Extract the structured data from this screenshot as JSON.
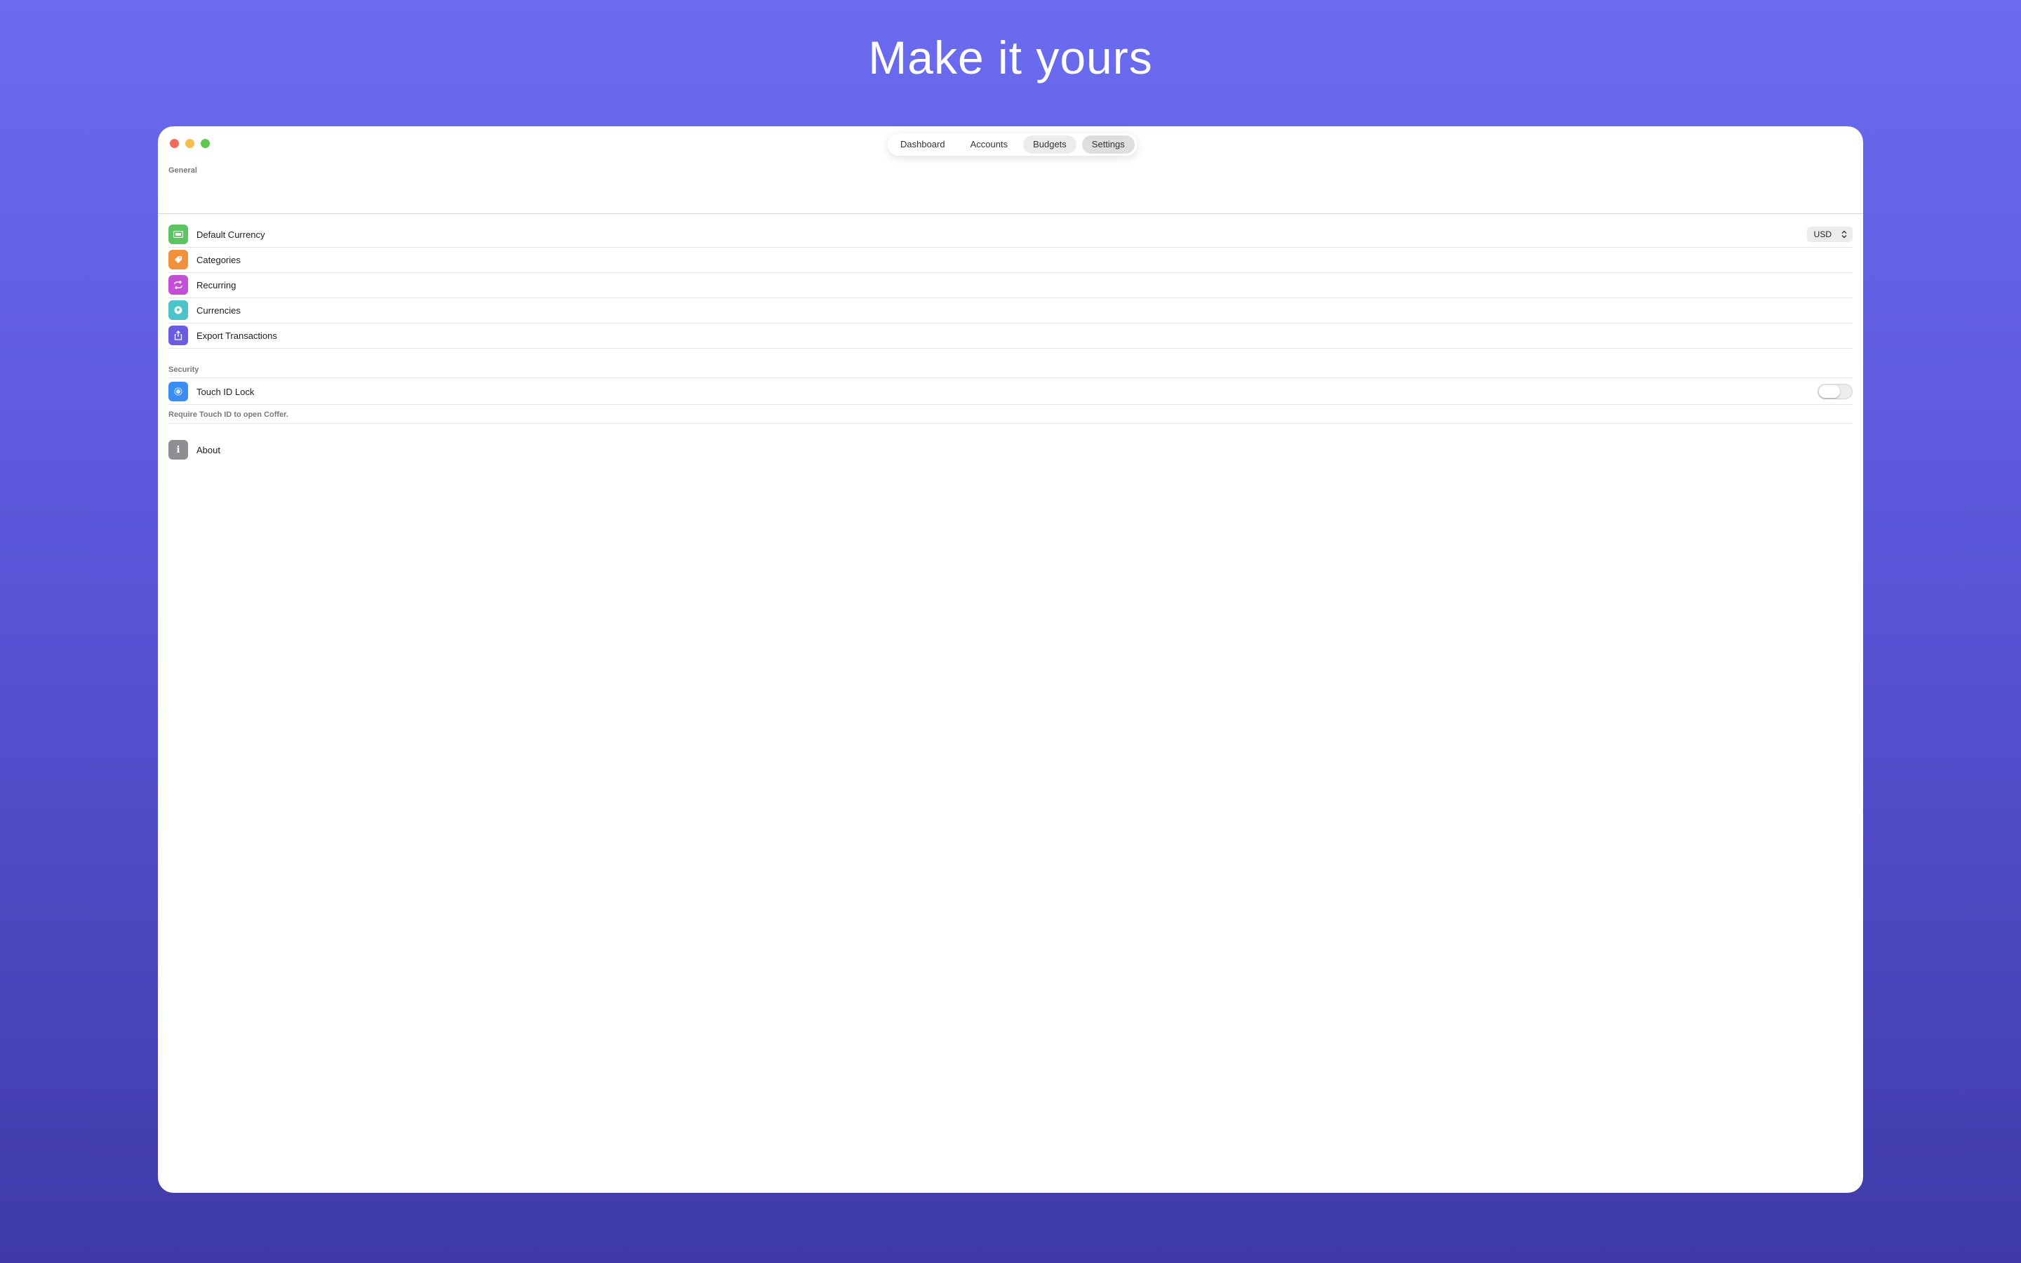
{
  "hero": {
    "title": "Make it yours"
  },
  "tabs": [
    {
      "label": "Dashboard"
    },
    {
      "label": "Accounts"
    },
    {
      "label": "Budgets"
    },
    {
      "label": "Settings"
    }
  ],
  "active_tab": "Settings",
  "general": {
    "header": "General",
    "items": [
      {
        "label": "Default Currency",
        "icon": "banknote-icon",
        "color": "#5cc463"
      },
      {
        "label": "Categories",
        "icon": "tag-icon",
        "color": "#f2913c"
      },
      {
        "label": "Recurring",
        "icon": "repeat-icon",
        "color": "#c24fd6"
      },
      {
        "label": "Currencies",
        "icon": "globe-icon",
        "color": "#4cc2c9"
      },
      {
        "label": "Export Transactions",
        "icon": "share-icon",
        "color": "#6a5ce0"
      }
    ],
    "currency_value": "USD"
  },
  "security": {
    "header": "Security",
    "touch_id_label": "Touch ID Lock",
    "touch_id_icon": "fingerprint-icon",
    "touch_id_color": "#3a8ef2",
    "touch_id_enabled": false,
    "footnote": "Require Touch ID to open Coffer."
  },
  "about": {
    "label": "About",
    "icon": "info-icon",
    "color": "#8e8e93"
  }
}
